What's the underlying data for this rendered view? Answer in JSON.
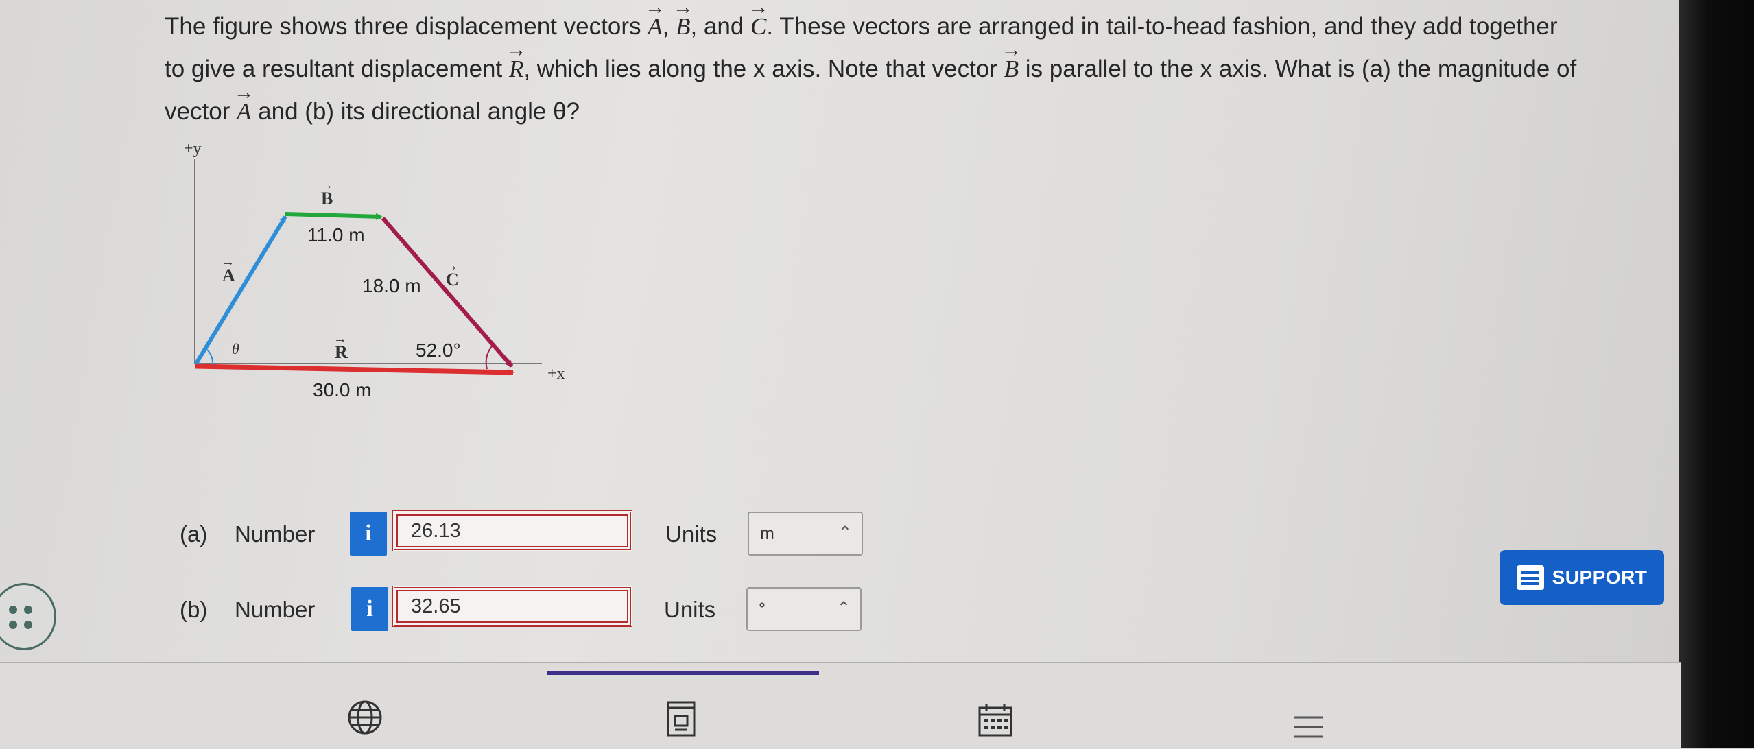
{
  "question": {
    "line1": [
      "The figure shows three displacement vectors ",
      "A",
      ", ",
      "B",
      ", and ",
      "C",
      ". These vectors are arranged in tail-to-head fashion, and they add together"
    ],
    "line2": [
      "to give a resultant displacement ",
      "R",
      ", which lies along the x axis. Note that vector ",
      "B",
      " is parallel to the x axis. What is (a) the magnitude of"
    ],
    "line3": [
      "vector ",
      "A",
      " and (b) its directional angle θ?"
    ]
  },
  "figure": {
    "y_axis_label": "+y",
    "x_axis_label": "+x",
    "vector_A_label": "A",
    "vector_B_label": "B",
    "vector_C_label": "C",
    "vector_R_label": "R",
    "theta_label": "θ",
    "B_magnitude": "11.0 m",
    "C_magnitude": "18.0 m",
    "R_magnitude": "30.0 m",
    "C_angle": "52.0°",
    "colors": {
      "A": "#2f8ed8",
      "B": "#22a83a",
      "C": "#a21d4c",
      "R": "#dc2e2e",
      "axis": "#777777"
    }
  },
  "answers": {
    "a": {
      "part": "(a)",
      "label": "Number",
      "info": "i",
      "value": "26.13",
      "units_label": "Units",
      "unit": "m"
    },
    "b": {
      "part": "(b)",
      "label": "Number",
      "info": "i",
      "value": "32.65",
      "units_label": "Units",
      "unit": "°"
    }
  },
  "support": {
    "label": "SUPPORT"
  },
  "bottom_nav": {
    "icons": [
      "globe-icon",
      "document-icon",
      "calendar-icon",
      "menu-icon"
    ]
  }
}
